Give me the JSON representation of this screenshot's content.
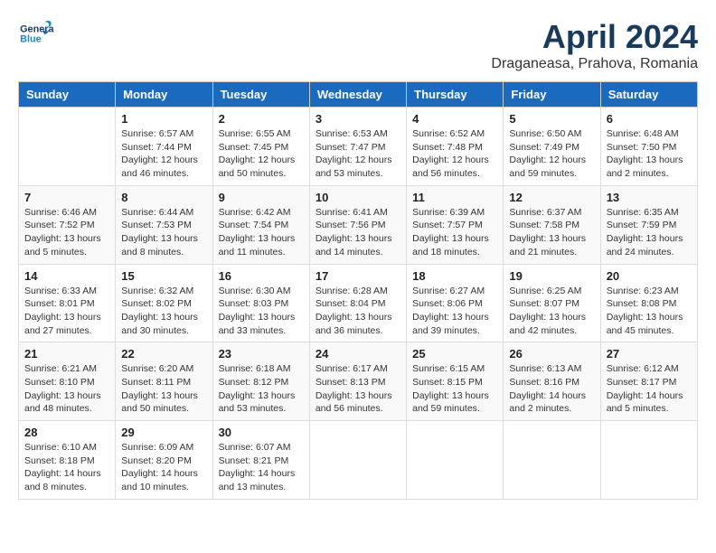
{
  "header": {
    "logo_general": "General",
    "logo_blue": "Blue",
    "month_title": "April 2024",
    "location": "Draganeasa, Prahova, Romania"
  },
  "weekdays": [
    "Sunday",
    "Monday",
    "Tuesday",
    "Wednesday",
    "Thursday",
    "Friday",
    "Saturday"
  ],
  "weeks": [
    [
      {
        "day": "",
        "info": ""
      },
      {
        "day": "1",
        "info": "Sunrise: 6:57 AM\nSunset: 7:44 PM\nDaylight: 12 hours\nand 46 minutes."
      },
      {
        "day": "2",
        "info": "Sunrise: 6:55 AM\nSunset: 7:45 PM\nDaylight: 12 hours\nand 50 minutes."
      },
      {
        "day": "3",
        "info": "Sunrise: 6:53 AM\nSunset: 7:47 PM\nDaylight: 12 hours\nand 53 minutes."
      },
      {
        "day": "4",
        "info": "Sunrise: 6:52 AM\nSunset: 7:48 PM\nDaylight: 12 hours\nand 56 minutes."
      },
      {
        "day": "5",
        "info": "Sunrise: 6:50 AM\nSunset: 7:49 PM\nDaylight: 12 hours\nand 59 minutes."
      },
      {
        "day": "6",
        "info": "Sunrise: 6:48 AM\nSunset: 7:50 PM\nDaylight: 13 hours\nand 2 minutes."
      }
    ],
    [
      {
        "day": "7",
        "info": "Sunrise: 6:46 AM\nSunset: 7:52 PM\nDaylight: 13 hours\nand 5 minutes."
      },
      {
        "day": "8",
        "info": "Sunrise: 6:44 AM\nSunset: 7:53 PM\nDaylight: 13 hours\nand 8 minutes."
      },
      {
        "day": "9",
        "info": "Sunrise: 6:42 AM\nSunset: 7:54 PM\nDaylight: 13 hours\nand 11 minutes."
      },
      {
        "day": "10",
        "info": "Sunrise: 6:41 AM\nSunset: 7:56 PM\nDaylight: 13 hours\nand 14 minutes."
      },
      {
        "day": "11",
        "info": "Sunrise: 6:39 AM\nSunset: 7:57 PM\nDaylight: 13 hours\nand 18 minutes."
      },
      {
        "day": "12",
        "info": "Sunrise: 6:37 AM\nSunset: 7:58 PM\nDaylight: 13 hours\nand 21 minutes."
      },
      {
        "day": "13",
        "info": "Sunrise: 6:35 AM\nSunset: 7:59 PM\nDaylight: 13 hours\nand 24 minutes."
      }
    ],
    [
      {
        "day": "14",
        "info": "Sunrise: 6:33 AM\nSunset: 8:01 PM\nDaylight: 13 hours\nand 27 minutes."
      },
      {
        "day": "15",
        "info": "Sunrise: 6:32 AM\nSunset: 8:02 PM\nDaylight: 13 hours\nand 30 minutes."
      },
      {
        "day": "16",
        "info": "Sunrise: 6:30 AM\nSunset: 8:03 PM\nDaylight: 13 hours\nand 33 minutes."
      },
      {
        "day": "17",
        "info": "Sunrise: 6:28 AM\nSunset: 8:04 PM\nDaylight: 13 hours\nand 36 minutes."
      },
      {
        "day": "18",
        "info": "Sunrise: 6:27 AM\nSunset: 8:06 PM\nDaylight: 13 hours\nand 39 minutes."
      },
      {
        "day": "19",
        "info": "Sunrise: 6:25 AM\nSunset: 8:07 PM\nDaylight: 13 hours\nand 42 minutes."
      },
      {
        "day": "20",
        "info": "Sunrise: 6:23 AM\nSunset: 8:08 PM\nDaylight: 13 hours\nand 45 minutes."
      }
    ],
    [
      {
        "day": "21",
        "info": "Sunrise: 6:21 AM\nSunset: 8:10 PM\nDaylight: 13 hours\nand 48 minutes."
      },
      {
        "day": "22",
        "info": "Sunrise: 6:20 AM\nSunset: 8:11 PM\nDaylight: 13 hours\nand 50 minutes."
      },
      {
        "day": "23",
        "info": "Sunrise: 6:18 AM\nSunset: 8:12 PM\nDaylight: 13 hours\nand 53 minutes."
      },
      {
        "day": "24",
        "info": "Sunrise: 6:17 AM\nSunset: 8:13 PM\nDaylight: 13 hours\nand 56 minutes."
      },
      {
        "day": "25",
        "info": "Sunrise: 6:15 AM\nSunset: 8:15 PM\nDaylight: 13 hours\nand 59 minutes."
      },
      {
        "day": "26",
        "info": "Sunrise: 6:13 AM\nSunset: 8:16 PM\nDaylight: 14 hours\nand 2 minutes."
      },
      {
        "day": "27",
        "info": "Sunrise: 6:12 AM\nSunset: 8:17 PM\nDaylight: 14 hours\nand 5 minutes."
      }
    ],
    [
      {
        "day": "28",
        "info": "Sunrise: 6:10 AM\nSunset: 8:18 PM\nDaylight: 14 hours\nand 8 minutes."
      },
      {
        "day": "29",
        "info": "Sunrise: 6:09 AM\nSunset: 8:20 PM\nDaylight: 14 hours\nand 10 minutes."
      },
      {
        "day": "30",
        "info": "Sunrise: 6:07 AM\nSunset: 8:21 PM\nDaylight: 14 hours\nand 13 minutes."
      },
      {
        "day": "",
        "info": ""
      },
      {
        "day": "",
        "info": ""
      },
      {
        "day": "",
        "info": ""
      },
      {
        "day": "",
        "info": ""
      }
    ]
  ]
}
